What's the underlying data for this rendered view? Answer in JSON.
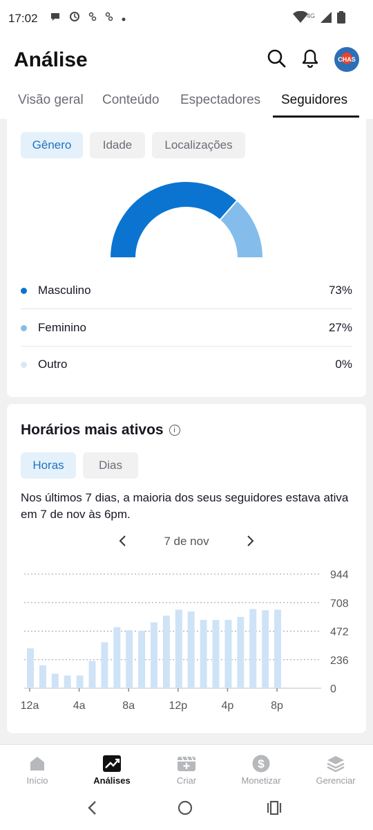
{
  "status_bar": {
    "time": "17:02",
    "network": "4G"
  },
  "header": {
    "title": "Análise",
    "avatar_text": "CHAS"
  },
  "tabs": [
    {
      "label": "Visão geral",
      "active": false
    },
    {
      "label": "Conteúdo",
      "active": false
    },
    {
      "label": "Espectadores",
      "active": false
    },
    {
      "label": "Seguidores",
      "active": true
    }
  ],
  "demographics": {
    "chips": [
      {
        "label": "Gênero",
        "active": true
      },
      {
        "label": "Idade",
        "active": false
      },
      {
        "label": "Localizações",
        "active": false
      }
    ],
    "gender": [
      {
        "label": "Masculino",
        "value": "73%",
        "share": 73,
        "color": "#0b74d1"
      },
      {
        "label": "Feminino",
        "value": "27%",
        "share": 27,
        "color": "#84bdeb"
      },
      {
        "label": "Outro",
        "value": "0%",
        "share": 0,
        "color": "#d6e8f8"
      }
    ]
  },
  "active_times": {
    "title": "Horários mais ativos",
    "chips": [
      {
        "label": "Horas",
        "active": true
      },
      {
        "label": "Dias",
        "active": false
      }
    ],
    "description": "Nos últimos 7 dias, a maioria dos seus seguidores estava ativa em 7 de nov às 6pm.",
    "date": "7 de nov"
  },
  "chart_data": {
    "type": "bar",
    "categories": [
      "12a",
      "1a",
      "2a",
      "3a",
      "4a",
      "5a",
      "6a",
      "7a",
      "8a",
      "9a",
      "10a",
      "11a",
      "12p",
      "1p",
      "2p",
      "3p",
      "4p",
      "5p",
      "6p",
      "7p",
      "8p"
    ],
    "x_tick_labels": [
      "12a",
      "4a",
      "8a",
      "12p",
      "4p",
      "8p"
    ],
    "values": [
      330,
      190,
      120,
      105,
      105,
      225,
      380,
      505,
      480,
      475,
      545,
      600,
      650,
      635,
      565,
      565,
      565,
      590,
      655,
      645,
      650
    ],
    "y_ticks": [
      "944",
      "708",
      "472",
      "236",
      "0"
    ],
    "ylim": [
      0,
      944
    ],
    "bar_color": "#cfe3f7",
    "grid": true
  },
  "bottom_nav": [
    {
      "label": "Início",
      "icon": "home-icon",
      "active": false
    },
    {
      "label": "Análises",
      "icon": "analytics-icon",
      "active": true
    },
    {
      "label": "Criar",
      "icon": "create-icon",
      "active": false
    },
    {
      "label": "Monetizar",
      "icon": "dollar-icon",
      "active": false
    },
    {
      "label": "Gerenciar",
      "icon": "layers-icon",
      "active": false
    }
  ]
}
